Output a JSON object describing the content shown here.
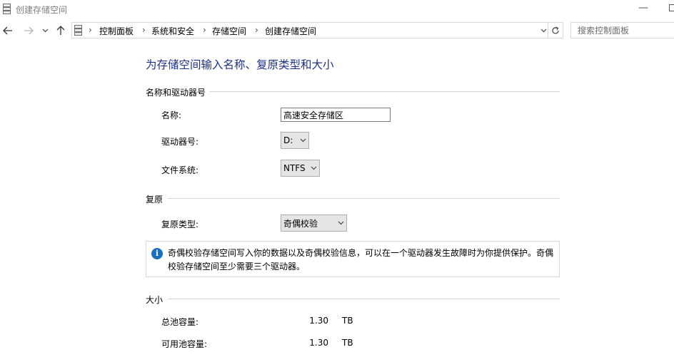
{
  "window": {
    "title": "创建存储空间",
    "app_icon": "storage-spaces-icon"
  },
  "nav": {
    "back_icon": "back-arrow-icon",
    "forward_icon": "forward-arrow-icon",
    "recent_icon": "chevron-down-icon",
    "up_icon": "up-arrow-icon",
    "breadcrumb": [
      "控制面板",
      "系统和安全",
      "存储空间",
      "创建存储空间"
    ],
    "refresh_icon": "refresh-icon",
    "search_placeholder": "搜索控制面板"
  },
  "page": {
    "heading": "为存储空间输入名称、复原类型和大小",
    "name_section": {
      "title": "名称和驱动器号",
      "name_label": "名称:",
      "name_value": "高速安全存储区",
      "drive_label": "驱动器号:",
      "drive_value": "D:",
      "fs_label": "文件系统:",
      "fs_value": "NTFS"
    },
    "resiliency_section": {
      "title": "复原",
      "type_label": "复原类型:",
      "type_value": "奇偶校验",
      "info_text": "奇偶校验存储空间写入你的数据以及奇偶校验信息，可以在一个驱动器发生故障时为你提供保护。奇偶校验存储空间至少需要三个驱动器。"
    },
    "size_section": {
      "title": "大小",
      "total_label": "总池容量:",
      "total_value": "1.30",
      "total_unit": "TB",
      "avail_label": "可用池容量:",
      "avail_value": "1.30",
      "avail_unit": "TB"
    }
  },
  "colors": {
    "heading": "#1e3287",
    "info_icon": "#1a6fbf"
  }
}
